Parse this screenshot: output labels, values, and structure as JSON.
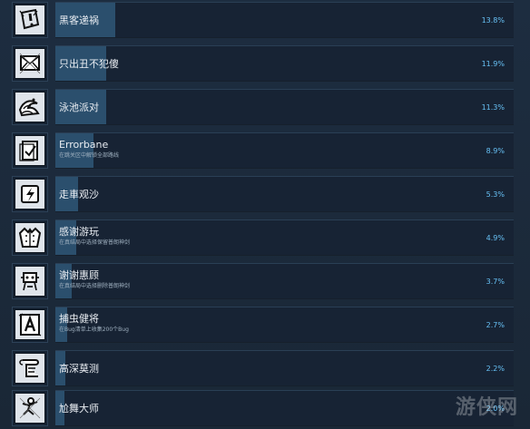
{
  "achievements": [
    {
      "title": "黑客递祸",
      "subtitle": "",
      "percent": "13.8%",
      "fill": 0.13,
      "icon": "warning-icon"
    },
    {
      "title": "只出丑不犯傻",
      "subtitle": "",
      "percent": "11.9%",
      "fill": 0.11,
      "icon": "mail-icon"
    },
    {
      "title": "泳池派对",
      "subtitle": "",
      "percent": "11.3%",
      "fill": 0.11,
      "icon": "wave-icon"
    },
    {
      "title": "Errorbane",
      "subtitle": "在跳关区中解锁全部路线",
      "percent": "8.9%",
      "fill": 0.084,
      "icon": "checklist-icon"
    },
    {
      "title": "走車观沙",
      "subtitle": "",
      "percent": "5.3%",
      "fill": 0.05,
      "icon": "lightning-icon"
    },
    {
      "title": "感谢游玩",
      "subtitle": "在真结局中选择保留普朗神剑",
      "percent": "4.9%",
      "fill": 0.046,
      "icon": "jacket-icon"
    },
    {
      "title": "谢谢惠顾",
      "subtitle": "在真结局中选择删除普朗神剑",
      "percent": "3.7%",
      "fill": 0.035,
      "icon": "robot-icon"
    },
    {
      "title": "捕虫健将",
      "subtitle": "在Bug清单上收集200个Bug",
      "percent": "2.7%",
      "fill": 0.025,
      "icon": "a-icon"
    },
    {
      "title": "高深莫测",
      "subtitle": "",
      "percent": "2.2%",
      "fill": 0.021,
      "icon": "scroll-icon"
    },
    {
      "title": "尬舞大师",
      "subtitle": "",
      "percent": "2.0%",
      "fill": 0.019,
      "icon": "dance-icon"
    }
  ],
  "watermark": "游侠网",
  "colors": {
    "background": "#1b2838",
    "bar": "#2b4f6d",
    "percent": "#67c1f5",
    "text": "#e9edf2"
  }
}
